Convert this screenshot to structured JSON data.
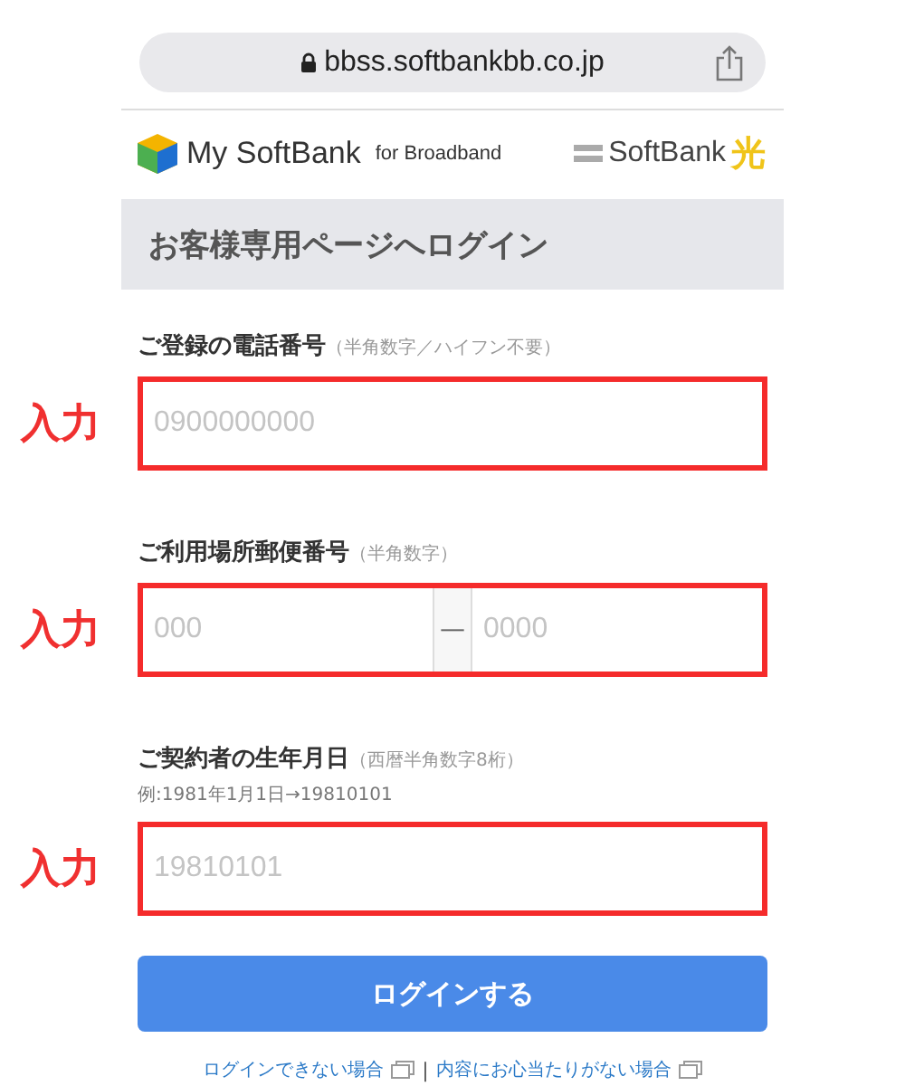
{
  "browser": {
    "url": "bbss.softbankbb.co.jp"
  },
  "header": {
    "brand": "My SoftBank",
    "brand_suffix": "for Broadband",
    "partner": "SoftBank",
    "partner_mark": "光"
  },
  "title": "お客様専用ページへログイン",
  "fields": [
    {
      "kind": "single",
      "label": "ご登録の電話番号",
      "note": "（半角数字／ハイフン不要）",
      "annotation": "入力",
      "highlighted": true,
      "placeholders": [
        "0900000000"
      ]
    },
    {
      "kind": "split",
      "label": "ご利用場所郵便番号",
      "note": "（半角数字）",
      "annotation": "入力",
      "highlighted": true,
      "separator": "—",
      "placeholders": [
        "000",
        "0000"
      ]
    },
    {
      "kind": "single",
      "label": "ご契約者の生年月日",
      "note": "（西暦半角数字8桁）",
      "example": "例:1981年1月1日→19810101",
      "annotation": "入力",
      "highlighted": true,
      "placeholders": [
        "19810101"
      ]
    }
  ],
  "button": "ログインする",
  "links": [
    "ログインできない場合",
    "内容にお心当たりがない場合"
  ],
  "link_separator": "|"
}
